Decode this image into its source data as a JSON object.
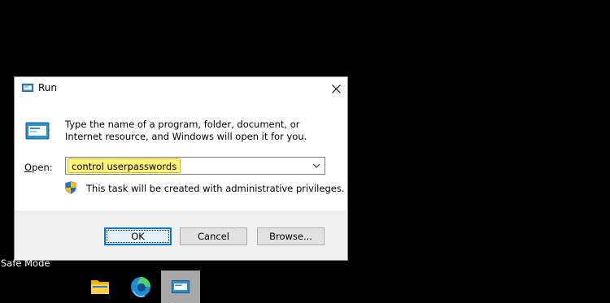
{
  "desktop": {
    "safe_mode_label": "Safe Mode"
  },
  "dialog": {
    "title": "Run",
    "title_icon": "run-icon",
    "close_icon": "close-icon",
    "description": "Type the name of a program, folder, document, or Internet resource, and Windows will open it for you.",
    "open_label_accel": "O",
    "open_label_rest": "pen:",
    "open_value": "control userpasswords",
    "admin_note": "This task will be created with administrative privileges.",
    "buttons": {
      "ok": "OK",
      "cancel": "Cancel",
      "browse": "Browse..."
    }
  },
  "taskbar": {
    "items": [
      {
        "name": "File Explorer",
        "icon": "folder-icon"
      },
      {
        "name": "Microsoft Edge",
        "icon": "edge-icon"
      },
      {
        "name": "Run",
        "icon": "run-icon",
        "active": true
      }
    ]
  },
  "colors": {
    "highlight": "#fff27a",
    "accent": "#0078d7"
  }
}
